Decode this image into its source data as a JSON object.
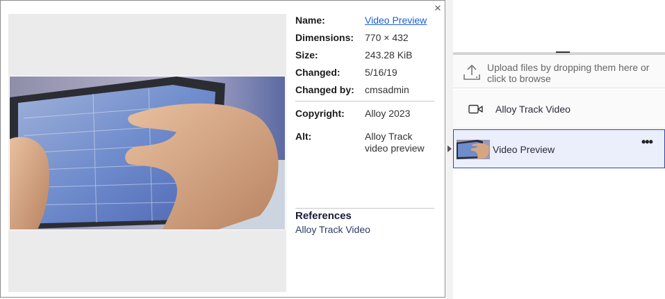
{
  "popover": {
    "close_label": "×",
    "details": {
      "name_label": "Name:",
      "name_value": "Video Preview",
      "dimensions_label": "Dimensions:",
      "dimensions_value": "770 × 432",
      "size_label": "Size:",
      "size_value": "243.28 KiB",
      "changed_label": "Changed:",
      "changed_value": "5/16/19",
      "changed_by_label": "Changed by:",
      "changed_by_value": "cmsadmin",
      "copyright_label": "Copyright:",
      "copyright_value": "Alloy 2023",
      "alt_label": "Alt:",
      "alt_value": "Alloy Track video preview"
    },
    "references": {
      "title": "References",
      "items": [
        "Alloy Track Video"
      ]
    }
  },
  "panel": {
    "upload_text": "Upload files by dropping them here or click to browse",
    "items": [
      {
        "label": "Alloy Track Video",
        "icon": "video-camera-icon"
      },
      {
        "label": "Video Preview",
        "icon": "image-thumbnail",
        "selected": true,
        "menu": "•••"
      }
    ]
  },
  "colors": {
    "link": "#1a5fd1",
    "selected_bg": "#ebeefb",
    "selected_border": "#2c4aa8",
    "preview_bg": "#ebebeb"
  }
}
